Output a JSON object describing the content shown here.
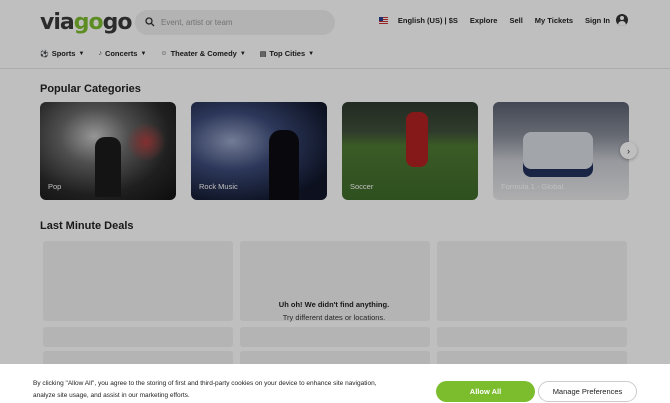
{
  "header": {
    "logo_a": "via",
    "logo_b": "go",
    "logo_c": "go",
    "search_placeholder": "Event, artist or team",
    "nav": {
      "locale": "English (US) | $S",
      "explore": "Explore",
      "sell": "Sell",
      "my_tickets": "My Tickets",
      "sign_in": "Sign In"
    }
  },
  "categories_bar": [
    {
      "label": "Sports",
      "icon": "ball-icon"
    },
    {
      "label": "Concerts",
      "icon": "guitar-icon"
    },
    {
      "label": "Theater & Comedy",
      "icon": "mask-icon"
    },
    {
      "label": "Top Cities",
      "icon": "building-icon"
    }
  ],
  "popular": {
    "title": "Popular Categories",
    "cards": [
      "Pop",
      "Rock Music",
      "Soccer",
      "Formula 1 - Global"
    ]
  },
  "deals": {
    "title": "Last Minute Deals",
    "empty_title": "Uh oh! We didn't find anything.",
    "empty_subtitle": "Try different dates or locations."
  },
  "cookie": {
    "text": "By clicking \"Allow All\", you agree to the storing of first and third-party cookies on your device to enhance site navigation, analyze site usage, and assist in our marketing efforts.",
    "allow_all": "Allow All",
    "manage": "Manage Preferences"
  },
  "colors": {
    "brand_green": "#7cbd2e"
  }
}
